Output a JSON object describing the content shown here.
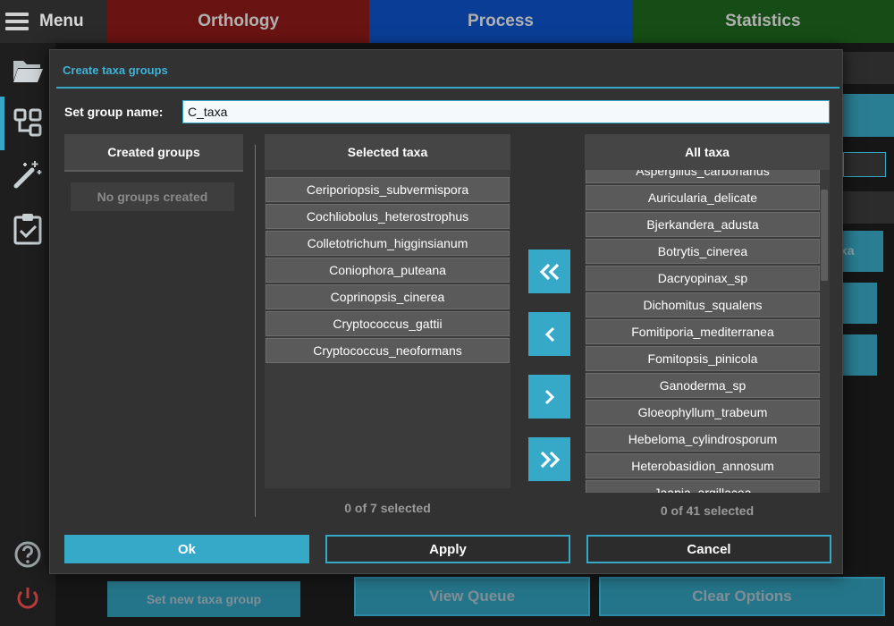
{
  "app": {
    "menu_label": "Menu",
    "tabs": [
      "Orthology",
      "Process",
      "Statistics"
    ],
    "bottom_buttons": {
      "set_new_taxa_group": "Set new taxa group",
      "view_queue": "View Queue",
      "clear_options": "Clear Options"
    },
    "right_fragment": "xa"
  },
  "dialog": {
    "title": "Create taxa groups",
    "group_name_label": "Set group name:",
    "group_name_value": "C_taxa",
    "created_groups_header": "Created groups",
    "no_groups_text": "No groups created",
    "selected_taxa_header": "Selected taxa",
    "all_taxa_header": "All taxa",
    "selected_taxa": [
      "Ceriporiopsis_subvermispora",
      "Cochliobolus_heterostrophus",
      "Colletotrichum_higginsianum",
      "Coniophora_puteana",
      "Coprinopsis_cinerea",
      "Cryptococcus_gattii",
      "Cryptococcus_neoformans"
    ],
    "all_taxa": [
      "Aspergillus_carbonarius",
      "Auricularia_delicate",
      "Bjerkandera_adusta",
      "Botrytis_cinerea",
      "Dacryopinax_sp",
      "Dichomitus_squalens",
      "Fomitiporia_mediterranea",
      "Fomitopsis_pinicola",
      "Ganoderma_sp",
      "Gloeophyllum_trabeum",
      "Hebeloma_cylindrosporum",
      "Heterobasidion_annosum",
      "Jaapia_argillacea"
    ],
    "selected_count_text": "0 of 7 selected",
    "all_count_text": "0 of 41 selected",
    "ok_label": "Ok",
    "apply_label": "Apply",
    "cancel_label": "Cancel"
  },
  "colors": {
    "accent": "#36a9c9",
    "dialog_bg": "#323232",
    "list_item_bg": "#5a5a5a"
  }
}
